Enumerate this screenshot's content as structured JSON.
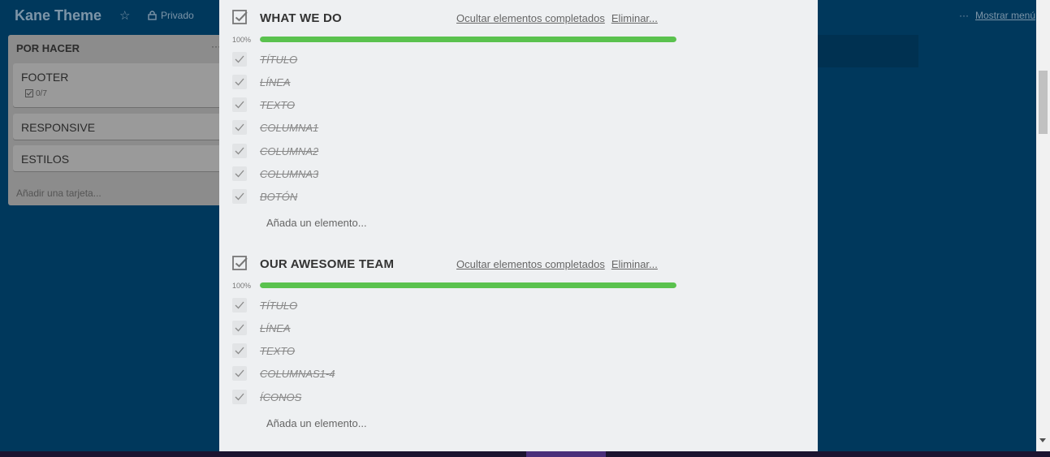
{
  "header": {
    "board_title": "Kane Theme",
    "visibility": "Privado",
    "more_dots": "···",
    "show_menu": "Mostrar menú"
  },
  "list": {
    "title": "POR HACER",
    "menu": "···",
    "cards": [
      {
        "title": "FOOTER",
        "badge": "0/7"
      },
      {
        "title": "RESPONSIVE"
      },
      {
        "title": "ESTILOS"
      }
    ],
    "add_card": "Añadir una tarjeta..."
  },
  "checklists": [
    {
      "title": "WHAT WE DO",
      "hide_completed": "Ocultar elementos completados",
      "delete": "Eliminar...",
      "percent": "100%",
      "progress": 1.0,
      "items": [
        "TÍTULO",
        "LÍNEA",
        "TEXTO",
        "COLUMNA1",
        "COLUMNA2",
        "COLUMNA3",
        "BOTÓN"
      ],
      "add_item": "Añada un elemento..."
    },
    {
      "title": "OUR AWESOME TEAM",
      "hide_completed": "Ocultar elementos completados",
      "delete": "Eliminar...",
      "percent": "100%",
      "progress": 1.0,
      "items": [
        "TÍTULO",
        "LÍNEA",
        "TEXTO",
        "COLUMNAS1-4",
        "ÍCONOS"
      ],
      "add_item": "Añada un elemento..."
    }
  ],
  "colors": {
    "board_bg": "#00385c",
    "progress_green": "#5ac24e",
    "modal_bg": "#eef0f2"
  }
}
